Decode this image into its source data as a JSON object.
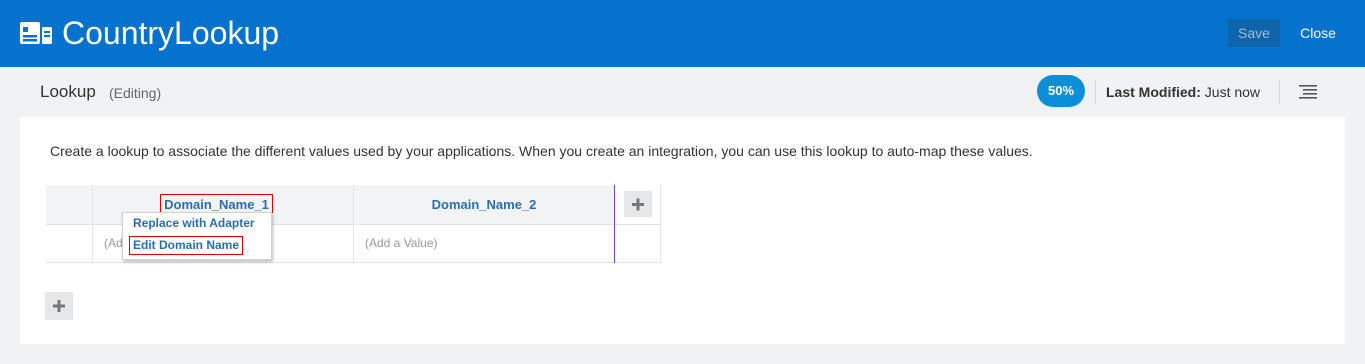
{
  "header": {
    "app_title": "CountryLookup",
    "app_icon": "lookup-document-icon",
    "save_label": "Save",
    "close_label": "Close"
  },
  "subbar": {
    "title": "Lookup",
    "status": "(Editing)",
    "progress": "50%",
    "last_modified_label": "Last Modified:",
    "last_modified_value": "Just now",
    "menu_icon": "list-menu-icon"
  },
  "main": {
    "description": "Create a lookup to associate the different values used by your applications. When you create an integration, you can use this lookup to auto-map these values.",
    "columns": [
      "Domain_Name_1",
      "Domain_Name_2"
    ],
    "rows": [
      {
        "values": [
          "(Add a Value)",
          "(Add a Value)"
        ]
      }
    ],
    "add_column_icon": "plus-icon",
    "add_row_icon": "plus-icon"
  },
  "context_menu": {
    "items": [
      "Replace with Adapter",
      "Edit Domain Name"
    ]
  },
  "colors": {
    "header_bg": "#0572ce",
    "link_blue": "#2b6eb0",
    "badge_blue": "#0c8fd9",
    "highlight_red": "#d60000"
  }
}
